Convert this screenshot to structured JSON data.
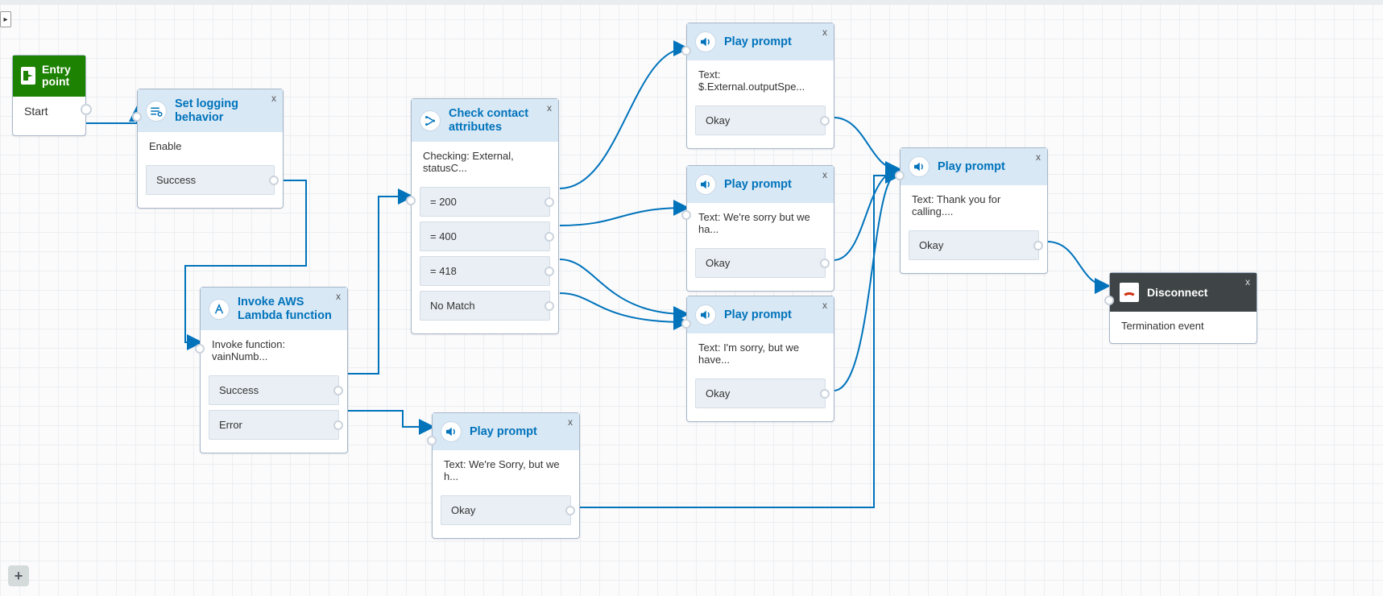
{
  "entry": {
    "title": "Entry point",
    "start": "Start"
  },
  "logging": {
    "title": "Set logging behavior",
    "subtitle": "Enable",
    "branch_success": "Success"
  },
  "lambda": {
    "title": "Invoke AWS Lambda function",
    "subtitle": "Invoke function: vainNumb...",
    "branch_success": "Success",
    "branch_error": "Error"
  },
  "check": {
    "title": "Check contact attributes",
    "subtitle": "Checking: External, statusC...",
    "b200": "= 200",
    "b400": "= 400",
    "b418": "= 418",
    "nomatch": "No Match"
  },
  "pp_error": {
    "title": "Play prompt",
    "text": "Text: We're Sorry, but we h...",
    "okay": "Okay"
  },
  "pp200": {
    "title": "Play prompt",
    "text": "Text: $.External.outputSpe...",
    "okay": "Okay"
  },
  "pp400": {
    "title": "Play prompt",
    "text": "Text: We're sorry but we ha...",
    "okay": "Okay"
  },
  "pp418": {
    "title": "Play prompt",
    "text": "Text: I'm sorry, but we have...",
    "okay": "Okay"
  },
  "ppthanks": {
    "title": "Play prompt",
    "text": "Text: Thank you for calling....",
    "okay": "Okay"
  },
  "disconnect": {
    "title": "Disconnect",
    "subtitle": "Termination event"
  },
  "close": "x",
  "side_arrow": "▸",
  "zoom": "+"
}
